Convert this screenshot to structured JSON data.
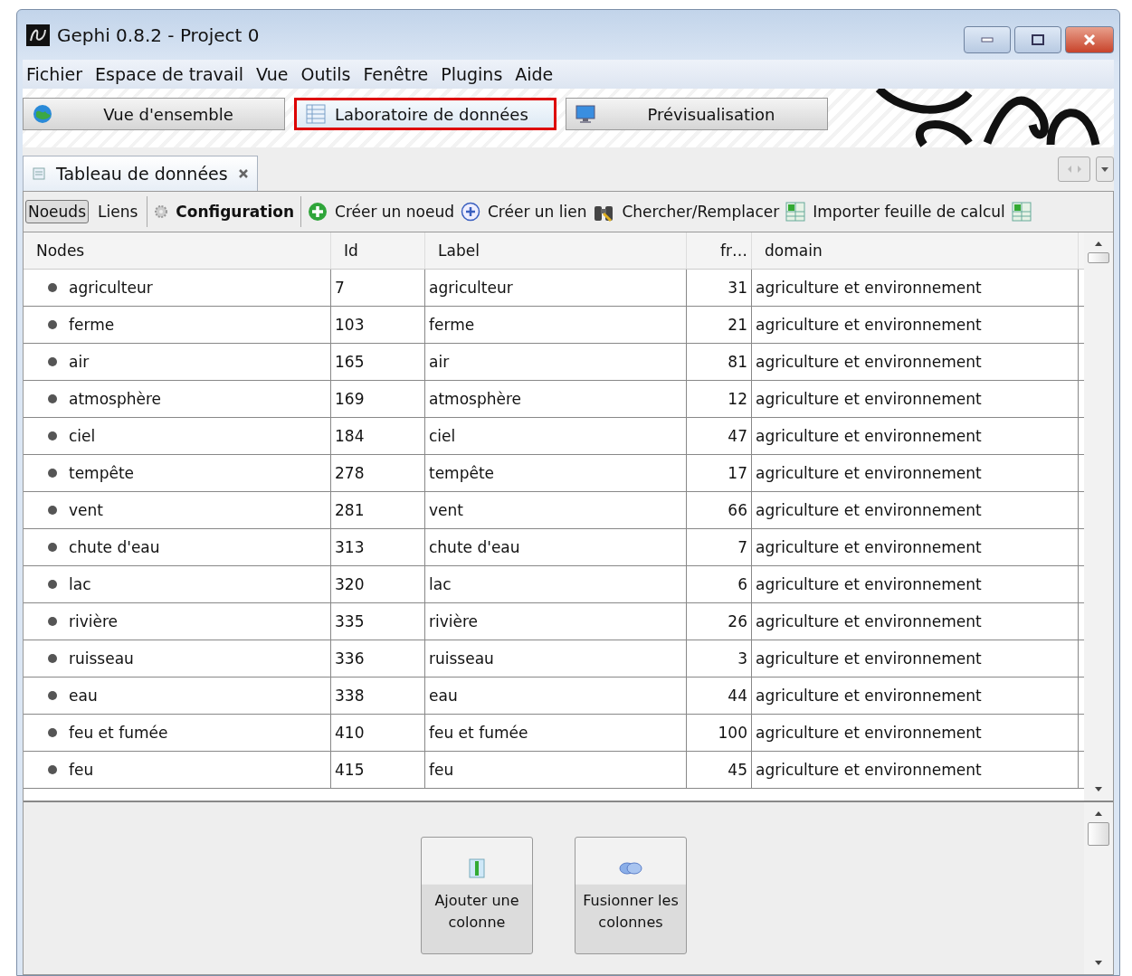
{
  "window": {
    "title": "Gephi 0.8.2 - Project 0"
  },
  "menu": [
    "Fichier",
    "Espace de travail",
    "Vue",
    "Outils",
    "Fenêtre",
    "Plugins",
    "Aide"
  ],
  "workspaces": [
    {
      "label": "Vue d'ensemble",
      "selected": false
    },
    {
      "label": "Laboratoire de données",
      "selected": true
    },
    {
      "label": "Prévisualisation",
      "selected": false
    }
  ],
  "document_tab": {
    "label": "Tableau de données"
  },
  "toolbar": {
    "views": [
      {
        "label": "Noeuds",
        "selected": true
      },
      {
        "label": "Liens",
        "selected": false
      }
    ],
    "actions": [
      {
        "label": "Configuration",
        "bold": true
      },
      {
        "label": "Créer un noeud",
        "bold": false
      },
      {
        "label": "Créer un lien",
        "bold": false
      },
      {
        "label": "Chercher/Remplacer",
        "bold": false
      },
      {
        "label": "Importer feuille de calcul",
        "bold": false
      }
    ]
  },
  "table": {
    "columns": [
      "Nodes",
      "Id",
      "Label",
      "fr…",
      "domain"
    ],
    "rows": [
      [
        "agriculteur",
        "7",
        "agriculteur",
        "31",
        "agriculture et environnement"
      ],
      [
        "ferme",
        "103",
        "ferme",
        "21",
        "agriculture et environnement"
      ],
      [
        "air",
        "165",
        "air",
        "81",
        "agriculture et environnement"
      ],
      [
        "atmosphère",
        "169",
        "atmosphère",
        "12",
        "agriculture et environnement"
      ],
      [
        "ciel",
        "184",
        "ciel",
        "47",
        "agriculture et environnement"
      ],
      [
        "tempête",
        "278",
        "tempête",
        "17",
        "agriculture et environnement"
      ],
      [
        "vent",
        "281",
        "vent",
        "66",
        "agriculture et environnement"
      ],
      [
        "chute d'eau",
        "313",
        "chute d'eau",
        "7",
        "agriculture et environnement"
      ],
      [
        "lac",
        "320",
        "lac",
        "6",
        "agriculture et environnement"
      ],
      [
        "rivière",
        "335",
        "rivière",
        "26",
        "agriculture et environnement"
      ],
      [
        "ruisseau",
        "336",
        "ruisseau",
        "3",
        "agriculture et environnement"
      ],
      [
        "eau",
        "338",
        "eau",
        "44",
        "agriculture et environnement"
      ],
      [
        "feu et fumée",
        "410",
        "feu et fumée",
        "100",
        "agriculture et environnement"
      ],
      [
        "feu",
        "415",
        "feu",
        "45",
        "agriculture et environnement"
      ]
    ]
  },
  "column_tools": [
    {
      "label": "Ajouter une colonne"
    },
    {
      "label": "Fusionner les colonnes"
    }
  ]
}
